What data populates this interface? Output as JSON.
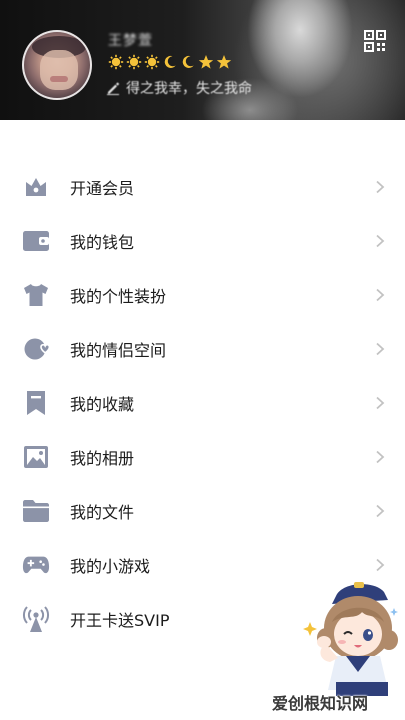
{
  "header": {
    "username": "王梦萱",
    "signature": "得之我幸，失之我命",
    "badges": [
      "sun-icon",
      "sun-icon",
      "sun-icon",
      "moon-icon",
      "moon-icon",
      "star-icon",
      "star-icon"
    ],
    "colors": {
      "badge_gold": "#f4c23a",
      "background": "#1a1a1a"
    }
  },
  "menu": {
    "items": [
      {
        "label": "开通会员",
        "icon": "crown-icon"
      },
      {
        "label": "我的钱包",
        "icon": "wallet-icon"
      },
      {
        "label": "我的个性装扮",
        "icon": "shirt-icon"
      },
      {
        "label": "我的情侣空间",
        "icon": "couple-heart-icon"
      },
      {
        "label": "我的收藏",
        "icon": "bookmark-icon"
      },
      {
        "label": "我的相册",
        "icon": "photo-icon"
      },
      {
        "label": "我的文件",
        "icon": "folder-icon"
      },
      {
        "label": "我的小游戏",
        "icon": "gamepad-icon"
      },
      {
        "label": "开王卡送SVIP",
        "icon": "signal-tower-icon"
      }
    ],
    "colors": {
      "icon": "#8c93a8",
      "chevron": "#c2c2c2"
    }
  },
  "watermark": {
    "text": "爱创根知识网"
  }
}
